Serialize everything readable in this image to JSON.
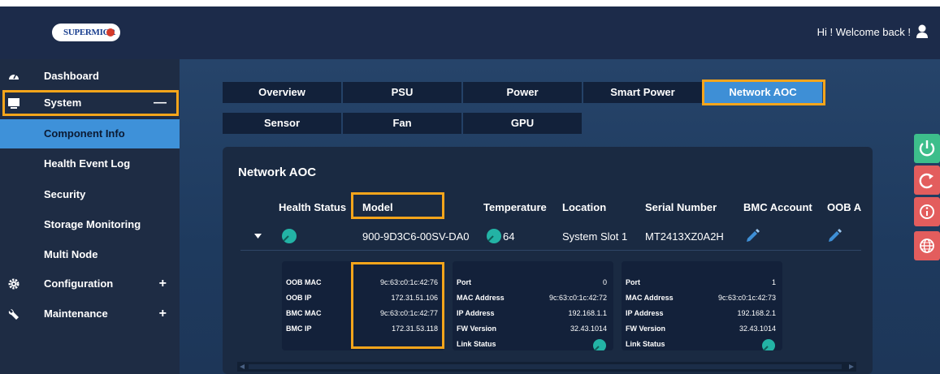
{
  "header": {
    "logo_text": "SUPERMICR",
    "welcome_text": "Hi ! Welcome back !"
  },
  "sidebar": {
    "items": [
      {
        "label": "Dashboard",
        "icon": "dashboard-icon"
      },
      {
        "label": "System",
        "icon": "monitor-icon",
        "expander": "—"
      },
      {
        "label": "Component Info"
      },
      {
        "label": "Health Event Log"
      },
      {
        "label": "Security"
      },
      {
        "label": "Storage Monitoring"
      },
      {
        "label": "Multi Node"
      },
      {
        "label": "Configuration",
        "icon": "gear-icon",
        "expander": "+"
      },
      {
        "label": "Maintenance",
        "icon": "wrench-icon",
        "expander": "+"
      }
    ]
  },
  "tabs": [
    "Overview",
    "PSU",
    "Power",
    "Smart Power",
    "Network AOC",
    "Sensor",
    "Fan",
    "GPU"
  ],
  "panel": {
    "title": "Network AOC",
    "columns": [
      "Health Status",
      "Model",
      "Temperature",
      "Location",
      "Serial Number",
      "BMC Account",
      "OOB A"
    ],
    "row": {
      "model": "900-9D3C6-00SV-DA0",
      "temperature": "64",
      "location": "System Slot 1",
      "serial": "MT2413XZ0A2H"
    },
    "oob_card": [
      {
        "key": "OOB MAC",
        "value": "9c:63:c0:1c:42:76"
      },
      {
        "key": "OOB IP",
        "value": "172.31.51.106"
      },
      {
        "key": "BMC MAC",
        "value": "9c:63:c0:1c:42:77"
      },
      {
        "key": "BMC IP",
        "value": "172.31.53.118"
      }
    ],
    "port_cards": [
      [
        {
          "key": "Port",
          "value": "0"
        },
        {
          "key": "MAC Address",
          "value": "9c:63:c0:1c:42:72"
        },
        {
          "key": "IP Address",
          "value": "192.168.1.1"
        },
        {
          "key": "FW Version",
          "value": "32.43.1014"
        },
        {
          "key": "Link Status",
          "value": ""
        }
      ],
      [
        {
          "key": "Port",
          "value": "1"
        },
        {
          "key": "MAC Address",
          "value": "9c:63:c0:1c:42:73"
        },
        {
          "key": "IP Address",
          "value": "192.168.2.1"
        },
        {
          "key": "FW Version",
          "value": "32.43.1014"
        },
        {
          "key": "Link Status",
          "value": ""
        }
      ]
    ]
  },
  "colors": {
    "accent": "#3e8fd6",
    "highlight": "#f5a51b",
    "status_ok": "#23b3a5",
    "power": "#3dbe8b",
    "reset": "#e35d5d"
  }
}
